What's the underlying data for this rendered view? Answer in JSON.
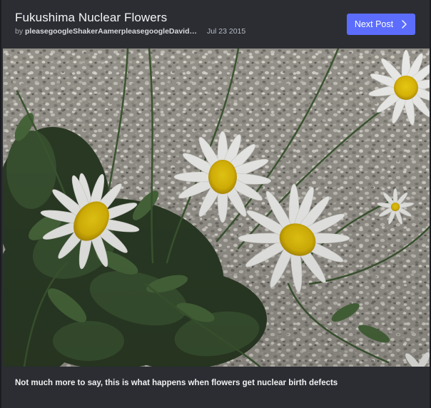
{
  "post": {
    "title": "Fukushima Nuclear Flowers",
    "by_label": "by",
    "author": "pleasegoogleShakerAamerpleasegoogleDavidKe...",
    "date": "Jul 23 2015",
    "next_label": "Next Post",
    "caption": "Not much more to say, this is what happens when flowers get nuclear birth defects"
  },
  "icons": {
    "next": "chevron-right-icon"
  },
  "colors": {
    "accent": "#5c6dfd",
    "background": "#2b2d33"
  }
}
